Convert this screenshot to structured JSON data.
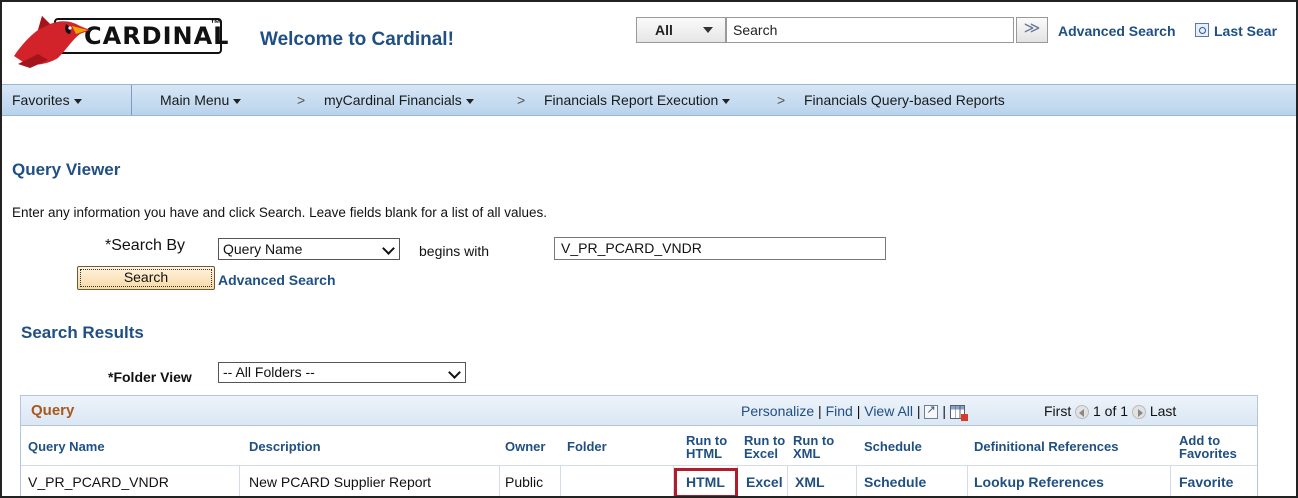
{
  "header": {
    "logo_text": "CARDINAL",
    "welcome": "Welcome to Cardinal!",
    "search_scope": "All",
    "search_value": "Search",
    "go_glyph": "≫",
    "advanced_search": "Advanced Search",
    "last_search": "Last Sear"
  },
  "nav": {
    "favorites": "Favorites",
    "main_menu": "Main Menu",
    "crumbs": [
      "myCardinal Financials",
      "Financials Report Execution",
      "Financials Query-based Reports"
    ],
    "chevron": ">"
  },
  "page": {
    "title": "Query Viewer",
    "instructions": "Enter any information you have and click Search. Leave fields blank for a list of all values.",
    "search_by_label": "*Search By",
    "search_by_value": "Query Name",
    "begins_with": "begins with",
    "query_name_value": "V_PR_PCARD_VNDR",
    "search_button": "Search",
    "advanced_search_link": "Advanced Search",
    "results_title": "Search Results",
    "folder_view_label": "*Folder View",
    "folder_view_value": "-- All Folders --"
  },
  "grid": {
    "title": "Query",
    "personalize": "Personalize",
    "find": "Find",
    "view_all": "View All",
    "pipe": "|",
    "first": "First",
    "page_count": "1 of 1",
    "last": "Last",
    "columns": {
      "query_name": "Query Name",
      "description": "Description",
      "owner": "Owner",
      "folder": "Folder",
      "run_html_1": "Run to",
      "run_html_2": "HTML",
      "run_excel_1": "Run to",
      "run_excel_2": "Excel",
      "run_xml_1": "Run to",
      "run_xml_2": "XML",
      "schedule": "Schedule",
      "def_refs": "Definitional References",
      "fav_1": "Add to",
      "fav_2": "Favorites"
    },
    "rows": [
      {
        "query_name": "V_PR_PCARD_VNDR",
        "description": "New PCARD Supplier Report",
        "owner": "Public",
        "folder": "",
        "html": "HTML",
        "excel": "Excel",
        "xml": "XML",
        "schedule": "Schedule",
        "lookup": "Lookup References",
        "favorite": "Favorite"
      }
    ]
  },
  "colors": {
    "link_blue": "#1f4f83",
    "grid_title": "#a8581d",
    "highlight": "#b11c2c",
    "nav_bg": "#c7dcf0"
  }
}
